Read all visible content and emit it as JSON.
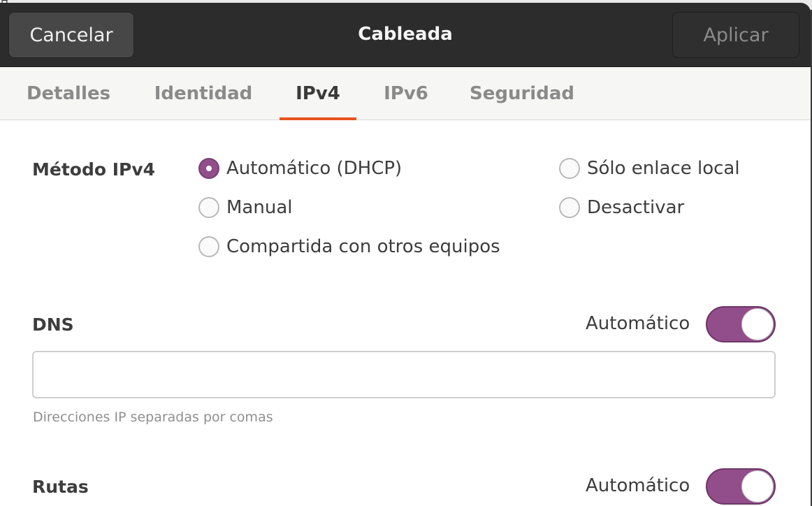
{
  "desktop": {
    "glyph": "ㅁ"
  },
  "headerbar": {
    "cancel_label": "Cancelar",
    "title": "Cableada",
    "apply_label": "Aplicar"
  },
  "tabs": [
    {
      "label": "Detalles",
      "active": false
    },
    {
      "label": "Identidad",
      "active": false
    },
    {
      "label": "IPv4",
      "active": true
    },
    {
      "label": "IPv6",
      "active": false
    },
    {
      "label": "Seguridad",
      "active": false
    }
  ],
  "ipv4_method": {
    "label": "Método IPv4",
    "options": [
      {
        "label": "Automático (DHCP)",
        "checked": true
      },
      {
        "label": "Manual",
        "checked": false
      },
      {
        "label": "Compartida con otros equipos",
        "checked": false
      },
      {
        "label": "Sólo enlace local",
        "checked": false
      },
      {
        "label": "Desactivar",
        "checked": false
      }
    ]
  },
  "dns": {
    "label": "DNS",
    "auto_label": "Automático",
    "auto_enabled": true,
    "value": "",
    "hint": "Direcciones IP separadas por comas"
  },
  "routes": {
    "label": "Rutas",
    "auto_label": "Automático",
    "auto_enabled": true
  },
  "colors": {
    "accent_tab": "#e95420",
    "switch_on": "#924d8b",
    "headerbar": "#2c2c2c"
  }
}
